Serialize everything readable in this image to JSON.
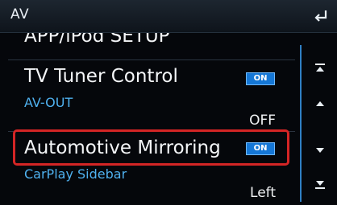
{
  "header": {
    "title": "AV",
    "back_icon": "back-return-icon"
  },
  "list": {
    "item_partial": "APP/iPod SETUP",
    "tv_tuner": {
      "label": "TV Tuner Control",
      "badge": "ON"
    },
    "av_out": {
      "label": "AV-OUT",
      "value": "OFF"
    },
    "automotive_mirroring": {
      "label": "Automotive Mirroring",
      "badge": "ON"
    },
    "carplay_sidebar": {
      "label": "CarPlay Sidebar",
      "value": "Left"
    }
  },
  "scroll": {
    "icons": [
      "scroll-top-icon",
      "scroll-up-icon",
      "scroll-down-icon",
      "scroll-bottom-icon"
    ]
  },
  "colors": {
    "accent": "#1577d6",
    "sub_label": "#4fb1ef",
    "highlight": "#d42525"
  }
}
